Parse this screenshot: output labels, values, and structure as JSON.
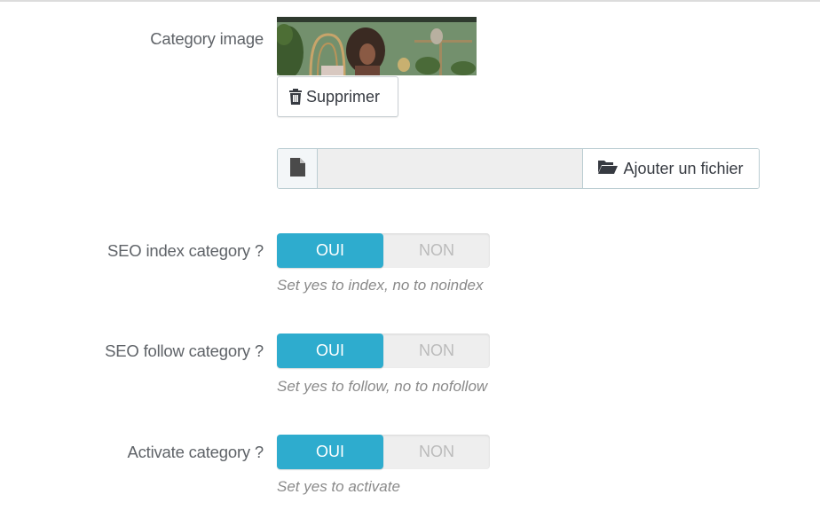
{
  "category_image": {
    "label": "Category image",
    "delete_button": "Supprimer",
    "add_file_button": "Ajouter un fichier",
    "file_input_value": ""
  },
  "fields": [
    {
      "label": "SEO index category ?",
      "on_label": "OUI",
      "off_label": "NON",
      "value": "OUI",
      "help": "Set yes to index, no to noindex"
    },
    {
      "label": "SEO follow category ?",
      "on_label": "OUI",
      "off_label": "NON",
      "value": "OUI",
      "help": "Set yes to follow, no to nofollow"
    },
    {
      "label": "Activate category ?",
      "on_label": "OUI",
      "off_label": "NON",
      "value": "OUI",
      "help": "Set yes to activate"
    }
  ],
  "colors": {
    "accent": "#2eacce",
    "switch_off_bg": "#eeeeee",
    "label_text": "#5f6368",
    "help_text": "#8a8a8a"
  }
}
